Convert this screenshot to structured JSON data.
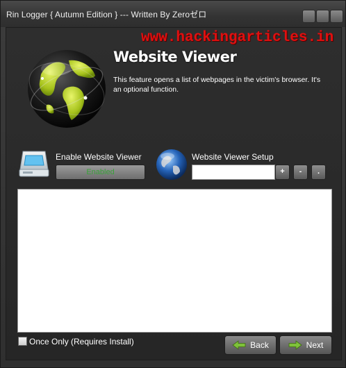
{
  "window": {
    "title": "Rin Logger  { Autumn Edition } --- Written By Zeroゼロ"
  },
  "watermark": "www.hackingarticles.in",
  "header": {
    "title": "Website Viewer",
    "description": "This feature opens a list of webpages in the victim's browser. It's an optional function."
  },
  "enable": {
    "label": "Enable Website Viewer",
    "button_label": "Enabled",
    "status_color": "#3aa03a"
  },
  "setup": {
    "label": "Website Viewer Setup",
    "input_value": "",
    "add_label": "+",
    "remove_label": "-",
    "dot_label": "."
  },
  "options": {
    "once_only_label": "Once Only (Requires Install)",
    "once_only_checked": false
  },
  "navigation": {
    "back_label": "Back",
    "next_label": "Next",
    "arrow_color": "#7ec23a"
  },
  "icons": {
    "globe": "globe-icon",
    "drive": "drive-icon",
    "small_globe": "small-globe-icon"
  }
}
